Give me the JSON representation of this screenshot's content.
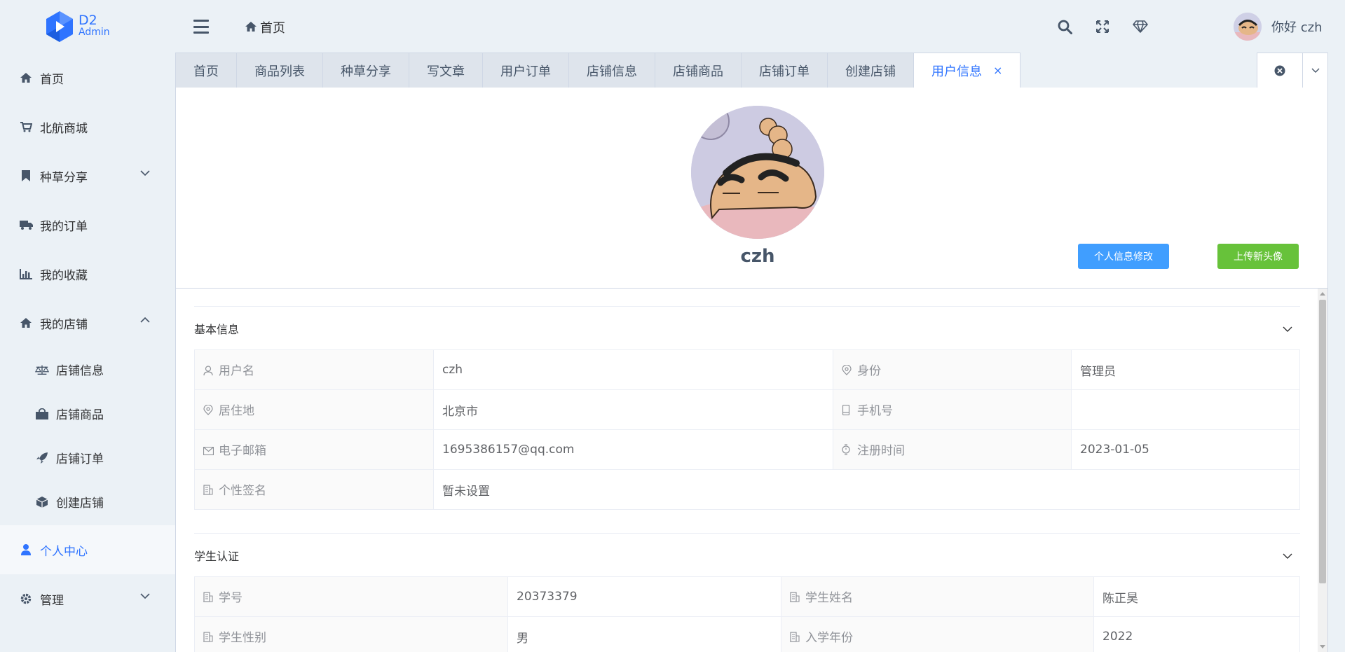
{
  "brand": {
    "line1": "D2",
    "line2": "Admin"
  },
  "sidebar": {
    "items": [
      {
        "label": "首页",
        "icon": "home-icon"
      },
      {
        "label": "北航商城",
        "icon": "cart-icon"
      },
      {
        "label": "种草分享",
        "icon": "bookmark-icon",
        "expandable": true
      },
      {
        "label": "我的订单",
        "icon": "truck-icon"
      },
      {
        "label": "我的收藏",
        "icon": "bar-chart-icon"
      },
      {
        "label": "我的店铺",
        "icon": "home-icon",
        "expanded": true
      },
      {
        "label": "店铺信息",
        "icon": "balance-scale-icon",
        "sub": true
      },
      {
        "label": "店铺商品",
        "icon": "shopping-bag-icon",
        "sub": true
      },
      {
        "label": "店铺订单",
        "icon": "rocket-icon",
        "sub": true
      },
      {
        "label": "创建店铺",
        "icon": "cube-icon",
        "sub": true
      },
      {
        "label": "个人中心",
        "icon": "user-icon",
        "active": true
      },
      {
        "label": "管理",
        "icon": "gear-icon",
        "expandable": true
      }
    ]
  },
  "header": {
    "breadcrumb": "首页",
    "greeting": "你好 czh"
  },
  "tabs": [
    "首页",
    "商品列表",
    "种草分享",
    "写文章",
    "用户订单",
    "店铺信息",
    "店铺商品",
    "店铺订单",
    "创建店铺",
    "用户信息"
  ],
  "active_tab": "用户信息",
  "profile": {
    "username": "czh",
    "edit_button": "个人信息修改",
    "upload_button": "上传新头像"
  },
  "basic_info": {
    "title": "基本信息",
    "rows": [
      [
        {
          "label": "用户名",
          "icon": "user-icon",
          "value": "czh"
        },
        {
          "label": "身份",
          "icon": "location-icon",
          "value": "管理员"
        }
      ],
      [
        {
          "label": "居住地",
          "icon": "location-icon",
          "value": "北京市"
        },
        {
          "label": "手机号",
          "icon": "mobile-icon",
          "value": ""
        }
      ],
      [
        {
          "label": "电子邮箱",
          "icon": "mail-icon",
          "value": "1695386157@qq.com"
        },
        {
          "label": "注册时间",
          "icon": "watch-icon",
          "value": "2023-01-05"
        }
      ],
      [
        {
          "label": "个性签名",
          "icon": "office-icon",
          "value": "暂未设置"
        }
      ]
    ]
  },
  "student_info": {
    "title": "学生认证",
    "rows": [
      [
        {
          "label": "学号",
          "icon": "office-icon",
          "value": "20373379"
        },
        {
          "label": "学生姓名",
          "icon": "office-icon",
          "value": "陈正昊"
        }
      ],
      [
        {
          "label": "学生性别",
          "icon": "office-icon",
          "value": "男"
        },
        {
          "label": "入学年份",
          "icon": "office-icon",
          "value": "2022"
        }
      ]
    ]
  },
  "colors": {
    "accent": "#2f74ff",
    "primary_button": "#409eff",
    "success_button": "#67c23a",
    "background": "#ebf1f6"
  }
}
